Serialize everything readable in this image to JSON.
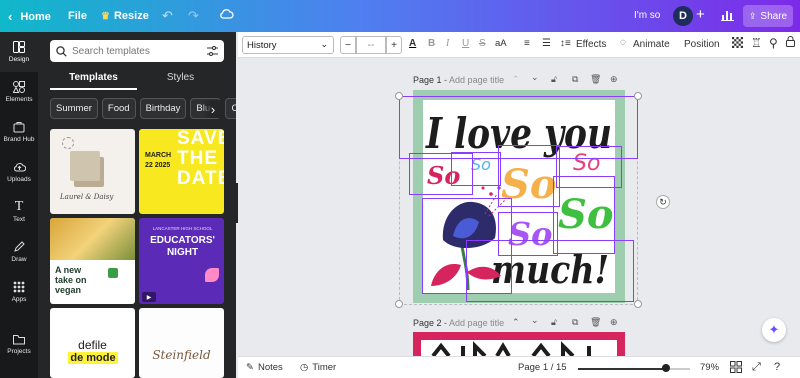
{
  "topbar": {
    "home_label": "Home",
    "file_label": "File",
    "resize_label": "Resize",
    "project_name": "I'm so",
    "avatar_initial": "D",
    "share_label": "Share"
  },
  "leftnav": {
    "items": [
      {
        "label": "Design"
      },
      {
        "label": "Elements"
      },
      {
        "label": "Brand Hub"
      },
      {
        "label": "Uploads"
      },
      {
        "label": "Text"
      },
      {
        "label": "Draw"
      },
      {
        "label": "Apps"
      },
      {
        "label": "Projects"
      }
    ]
  },
  "panel": {
    "search_placeholder": "Search templates",
    "tabs": [
      {
        "label": "Templates"
      },
      {
        "label": "Styles"
      }
    ],
    "chips": [
      {
        "label": "Summer"
      },
      {
        "label": "Food"
      },
      {
        "label": "Birthday"
      },
      {
        "label": "Blue"
      },
      {
        "label": "Co"
      }
    ],
    "templates": {
      "t1": {
        "text": "Laurel & Daisy"
      },
      "t2": {
        "big": "SAVE THE DATE",
        "date": "MARCH 22 2025"
      },
      "t3": {
        "line1": "A new take on",
        "line2": "vegan"
      },
      "t4": {
        "kicker": "LANCASTER HIGH SCHOOL",
        "title1": "EDUCATORS'",
        "title2": "NIGHT"
      },
      "t5": {
        "line1": "defile",
        "line2": "de mode"
      },
      "t6": {
        "text": "Steinfield"
      }
    }
  },
  "toolbar": {
    "font": "History",
    "size": "--",
    "effects_label": "Effects",
    "animate_label": "Animate",
    "position_label": "Position"
  },
  "page1": {
    "label": "Page 1",
    "title_placeholder": "Add page title",
    "artwork": {
      "line1": "I love you",
      "so_items": [
        "So",
        "So",
        "So",
        "So",
        "So",
        "So"
      ],
      "line3": "much!"
    }
  },
  "page2": {
    "label": "Page 2",
    "title_placeholder": "Add page title"
  },
  "bottombar": {
    "notes_label": "Notes",
    "timer_label": "Timer",
    "page_indicator": "Page 1 / 15",
    "zoom": "79%",
    "zoom_fraction": 0.79
  },
  "colors": {
    "accent_purple": "#8b3dff",
    "frame_green": "#9fcdb0",
    "so_red": "#d6245e",
    "so_blue": "#5ab4e8",
    "so_orange": "#f5b04a",
    "so_pink": "#e8417d",
    "so_green": "#3fbf3f",
    "so_violet": "#a855f7"
  }
}
